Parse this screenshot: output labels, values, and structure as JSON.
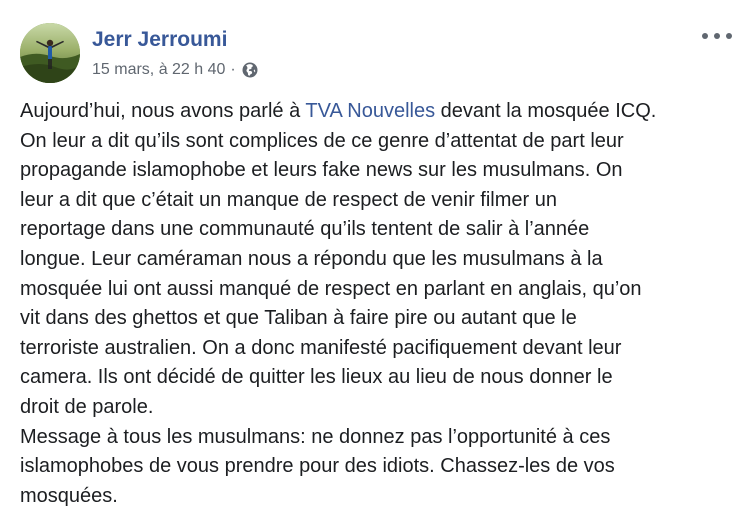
{
  "post": {
    "author": "Jerr Jerroumi",
    "timestamp": "15 mars, à 22 h 40",
    "separator": "·",
    "privacy_icon": "globe-icon",
    "menu_icon": "more-options-icon",
    "avatar_icon": "avatar"
  },
  "content": {
    "line1_before": "Aujourd’hui, nous avons parlé à ",
    "line1_link": "TVA Nouvelles",
    "line1_after": " devant la mosquée ICQ.",
    "lines": [
      "On leur a dit qu’ils sont complices de ce genre d’attentat de part leur",
      "propagande islamophobe et leurs fake news sur les musulmans. On",
      "leur a dit que c’était un manque de respect de venir filmer un",
      "reportage dans une communauté qu’ils tentent de salir à l’année",
      "longue. Leur caméraman nous a répondu que les musulmans à la",
      "mosquée lui ont aussi manqué de respect en parlant en anglais, qu’on",
      "vit dans des ghettos et que Taliban à faire pire ou autant que le",
      "terroriste australien. On a donc manifesté pacifiquement devant leur",
      "camera. Ils ont décidé de quitter les lieux au lieu de nous donner le",
      "droit de parole.",
      "Message à tous les musulmans: ne donnez pas l’opportunité à ces",
      "islamophobes de vous prendre pour des idiots. Chassez-les de vos",
      "mosquées."
    ]
  },
  "colors": {
    "author": "#385898",
    "meta": "#606770",
    "text": "#1c1e21",
    "link": "#385898"
  }
}
